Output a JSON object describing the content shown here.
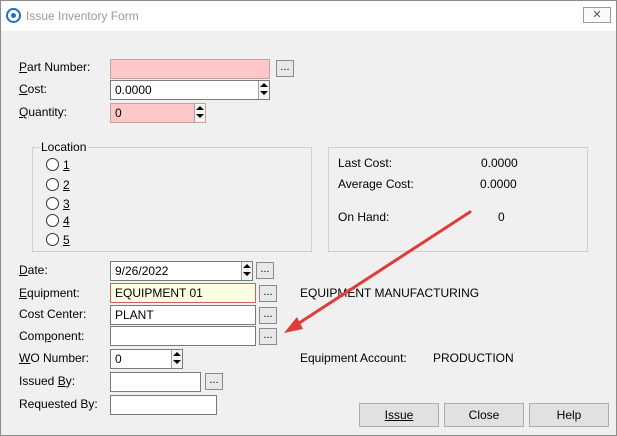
{
  "window": {
    "title": "Issue Inventory Form",
    "close_label": "✕"
  },
  "form": {
    "part_number": {
      "label": "Part Number:",
      "value": ""
    },
    "cost": {
      "label": "Cost:",
      "value": "0.0000"
    },
    "quantity": {
      "label": "Quantity:",
      "value": "0"
    },
    "date": {
      "label": "Date:",
      "value": "9/26/2022"
    },
    "equipment": {
      "label": "Equipment:",
      "value": "EQUIPMENT 01",
      "description": "EQUIPMENT MANUFACTURING"
    },
    "cost_center": {
      "label": "Cost Center:",
      "value": "PLANT"
    },
    "component": {
      "label": "Component:",
      "value": ""
    },
    "wo_number": {
      "label": "WO Number:",
      "value": "0"
    },
    "issued_by": {
      "label": "Issued By:",
      "value": ""
    },
    "requested_by": {
      "label": "Requested By:",
      "value": ""
    },
    "equipment_account": {
      "label": "Equipment Account:",
      "value": "PRODUCTION"
    },
    "ellipsis_label": "..."
  },
  "location": {
    "title": "Location",
    "options": [
      "1",
      "2",
      "3",
      "4",
      "5"
    ]
  },
  "cost_info": {
    "last_cost": {
      "label": "Last Cost:",
      "value": "0.0000"
    },
    "average_cost": {
      "label": "Average Cost:",
      "value": "0.0000"
    },
    "on_hand": {
      "label": "On Hand:",
      "value": "0"
    }
  },
  "buttons": {
    "issue": "Issue",
    "close": "Close",
    "help": "Help"
  },
  "colors": {
    "required_field": "#ffc8c8",
    "focused_field": "#ffffe1",
    "arrow": "#e03c3c"
  }
}
